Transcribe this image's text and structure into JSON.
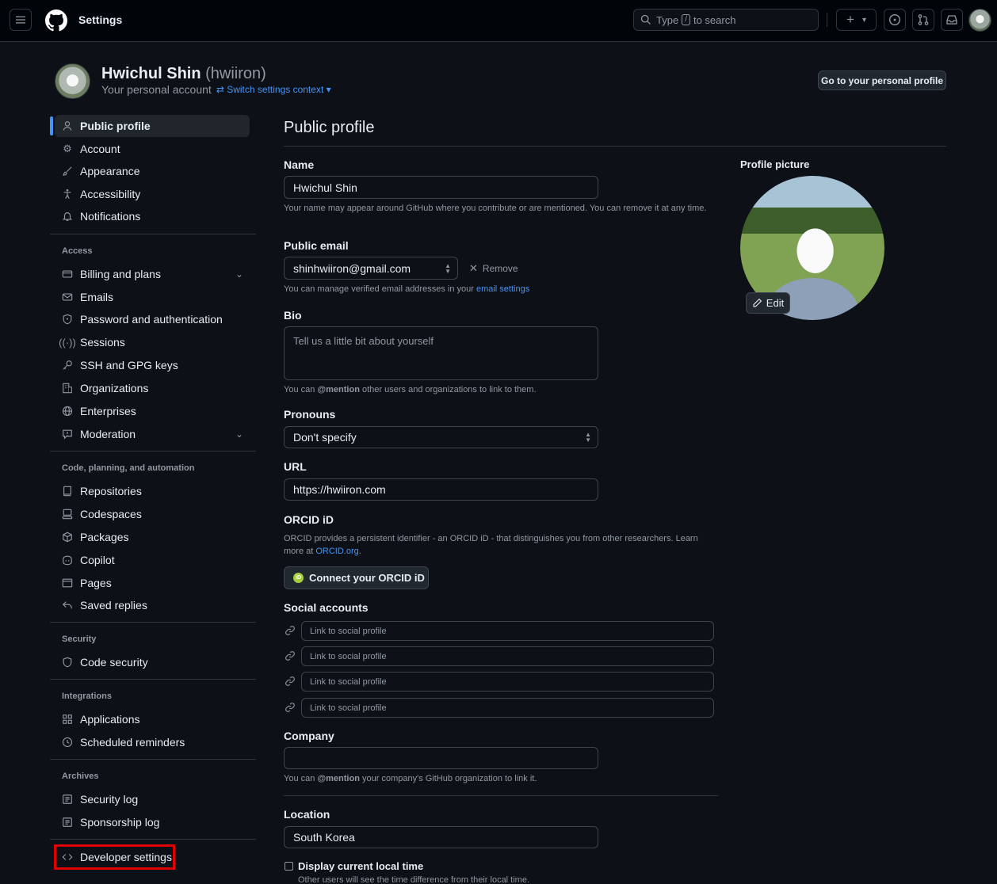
{
  "header": {
    "title": "Settings",
    "search_placeholder_pre": "Type",
    "search_slash": "/",
    "search_placeholder_post": "to search",
    "plus_label": "+",
    "chevron": "▾"
  },
  "account": {
    "name": "Hwichul Shin",
    "handle": "(hwiiron)",
    "subtitle": "Your personal account",
    "switch_label": "Switch settings context",
    "go_profile_label": "Go to your personal profile"
  },
  "sidebar": {
    "top_items": [
      {
        "label": "Public profile",
        "icon": "person-icon"
      },
      {
        "label": "Account",
        "icon": "gear-icon"
      },
      {
        "label": "Appearance",
        "icon": "paintbrush-icon"
      },
      {
        "label": "Accessibility",
        "icon": "accessibility-icon"
      },
      {
        "label": "Notifications",
        "icon": "bell-icon"
      }
    ],
    "access_heading": "Access",
    "access_items": [
      {
        "label": "Billing and plans",
        "icon": "credit-card-icon"
      },
      {
        "label": "Emails",
        "icon": "mail-icon"
      },
      {
        "label": "Password and authentication",
        "icon": "shield-lock-icon"
      },
      {
        "label": "Sessions",
        "icon": "broadcast-icon"
      },
      {
        "label": "SSH and GPG keys",
        "icon": "key-icon"
      },
      {
        "label": "Organizations",
        "icon": "organization-icon"
      },
      {
        "label": "Enterprises",
        "icon": "globe-icon"
      },
      {
        "label": "Moderation",
        "icon": "report-icon"
      }
    ],
    "code_heading": "Code, planning, and automation",
    "code_items": [
      {
        "label": "Repositories",
        "icon": "repo-icon"
      },
      {
        "label": "Codespaces",
        "icon": "codespaces-icon"
      },
      {
        "label": "Packages",
        "icon": "package-icon"
      },
      {
        "label": "Copilot",
        "icon": "copilot-icon"
      },
      {
        "label": "Pages",
        "icon": "browser-icon"
      },
      {
        "label": "Saved replies",
        "icon": "reply-icon"
      }
    ],
    "security_heading": "Security",
    "security_items": [
      {
        "label": "Code security",
        "icon": "shield-icon"
      }
    ],
    "integrations_heading": "Integrations",
    "integrations_items": [
      {
        "label": "Applications",
        "icon": "apps-icon"
      },
      {
        "label": "Scheduled reminders",
        "icon": "clock-icon"
      }
    ],
    "archives_heading": "Archives",
    "archives_items": [
      {
        "label": "Security log",
        "icon": "log-icon"
      },
      {
        "label": "Sponsorship log",
        "icon": "log-icon"
      }
    ],
    "developer_settings": "Developer settings"
  },
  "main": {
    "title": "Public profile",
    "name_label": "Name",
    "name_value": "Hwichul Shin",
    "name_note": "Your name may appear around GitHub where you contribute or are mentioned. You can remove it at any time.",
    "email_label": "Public email",
    "email_value": "shinhwiiron@gmail.com",
    "remove_label": "Remove",
    "email_note_pre": "You can manage verified email addresses in your",
    "email_note_link": "email settings",
    "bio_label": "Bio",
    "bio_placeholder": "Tell us a little bit about yourself",
    "bio_note_pre": "You can",
    "bio_note_mention": "@mention",
    "bio_note_post": "other users and organizations to link to them.",
    "pronouns_label": "Pronouns",
    "pronouns_value": "Don't specify",
    "url_label": "URL",
    "url_value": "https://hwiiron.com",
    "orcid_label": "ORCID iD",
    "orcid_note_pre": "ORCID provides a persistent identifier - an ORCID iD - that distinguishes you from other researchers. Learn more at",
    "orcid_note_link": "ORCID.org",
    "orcid_note_post": ".",
    "orcid_button": "Connect your ORCID iD",
    "orcid_badge": "iD",
    "social_label": "Social accounts",
    "social_placeholder": "Link to social profile",
    "company_label": "Company",
    "company_note_pre": "You can",
    "company_note_mention": "@mention",
    "company_note_post": "your company's GitHub organization to link it.",
    "location_label": "Location",
    "location_value": "South Korea",
    "local_time_label": "Display current local time",
    "local_time_note": "Other users will see the time difference from their local time."
  },
  "profile_picture": {
    "label": "Profile picture",
    "edit_label": "Edit"
  },
  "colors": {
    "accent": "#4493f8",
    "highlight": "#e00000",
    "background": "#0d1117"
  }
}
